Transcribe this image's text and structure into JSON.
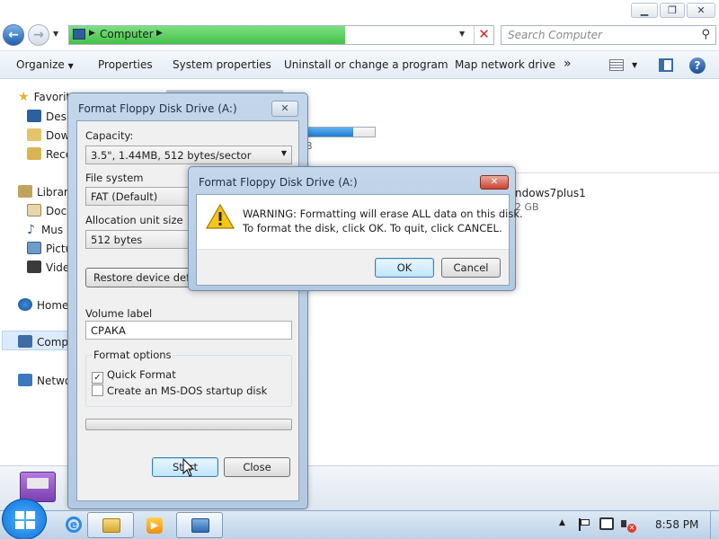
{
  "explorer": {
    "address": {
      "crumbs": [
        "Computer"
      ],
      "search_placeholder": "Search Computer",
      "progress": 0.65
    },
    "toolbar": {
      "organize": "Organize",
      "properties": "Properties",
      "system_properties": "System properties",
      "uninstall": "Uninstall or change a program",
      "map_drive": "Map network drive",
      "more": "»"
    },
    "nav": {
      "favorites": "Favorit",
      "desktop": "Desk",
      "downloads": "Dow",
      "recent": "Rece",
      "libraries": "Librari",
      "documents": "Docu",
      "music": "Mus",
      "pictures": "Pictu",
      "videos": "Vide",
      "homegroup": "Home",
      "computer": "Comp",
      "network": "Netwo"
    },
    "content": {
      "drive_size_fragment": "B",
      "drive_name": "ndows7plus1",
      "drive_size": "2 GB"
    }
  },
  "format_dialog": {
    "title": "Format Floppy Disk Drive (A:)",
    "close_glyph": "✕",
    "capacity_label": "Capacity:",
    "capacity_value": "3.5\", 1.44MB, 512 bytes/sector",
    "filesystem_label": "File system",
    "filesystem_value": "FAT (Default)",
    "allocation_label": "Allocation unit size",
    "allocation_value": "512 bytes",
    "restore_button": "Restore device defaults",
    "volume_label": "Volume label",
    "volume_value": "СРАКА",
    "format_options_label": "Format options",
    "quick_format": "Quick Format",
    "quick_format_checked": true,
    "msdos_disk": "Create an MS-DOS startup disk",
    "msdos_checked": false,
    "progress": 0,
    "start_button": "Start",
    "close_button": "Close"
  },
  "warning_dialog": {
    "title": "Format Floppy Disk Drive (A:)",
    "close_glyph": "✕",
    "line1": "WARNING: Formatting will erase ALL data on this disk.",
    "line2": "To format the disk, click OK. To quit, click CANCEL.",
    "ok_button": "OK",
    "cancel_button": "Cancel"
  },
  "taskbar": {
    "clock": "8:58 PM",
    "pinned": [
      "start-button",
      "internet-explorer-icon",
      "file-explorer-icon",
      "media-player-icon",
      "format-window-icon"
    ]
  },
  "colors": {
    "accent": "#3c7fb1",
    "address_progress": "#45c14a",
    "warning_close": "#c9452f"
  }
}
